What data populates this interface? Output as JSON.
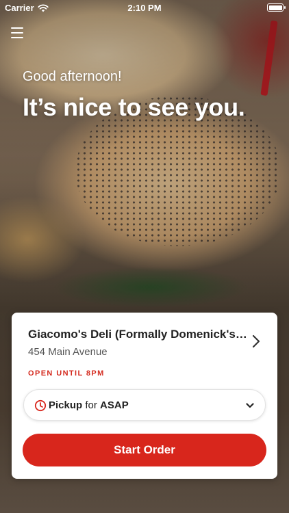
{
  "status_bar": {
    "carrier": "Carrier",
    "time": "2:10 PM"
  },
  "hero": {
    "greeting": "Good afternoon!",
    "headline": "It’s nice to see you."
  },
  "store": {
    "name": "Giacomo's Deli (Formally Domenick's Deli)",
    "name_display": "Giacomo's Deli (Formally Domenick's D...",
    "address": "454 Main Avenue",
    "hours_status": "OPEN UNTIL 8PM"
  },
  "order_mode": {
    "mode": "Pickup",
    "connector": "for",
    "time": "ASAP"
  },
  "actions": {
    "start_order_label": "Start Order"
  },
  "colors": {
    "accent": "#d8261c",
    "open_status": "#d42a1e",
    "card_bg": "#ffffff"
  },
  "icons": {
    "menu": "hamburger-menu-icon",
    "wifi": "wifi-icon",
    "battery": "battery-icon",
    "store_chevron": "chevron-right-icon",
    "clock": "clock-icon",
    "dropdown": "chevron-down-icon"
  }
}
